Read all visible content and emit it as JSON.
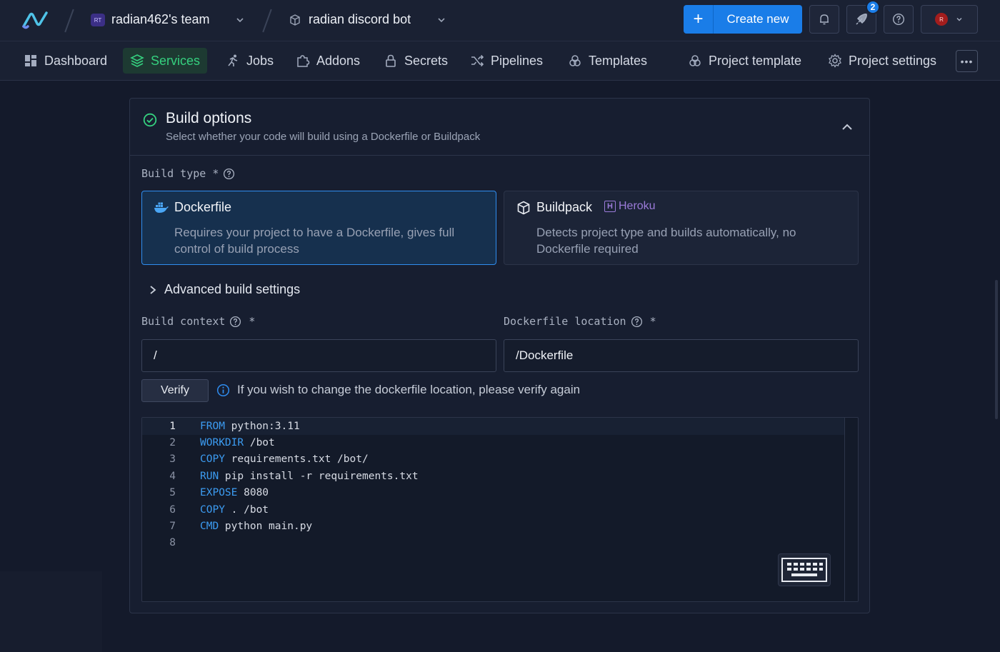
{
  "topbar": {
    "team_initials": "RT",
    "team_name": "radian462's team",
    "project_name": "radian discord bot",
    "create_label": "Create new",
    "notification_count": "2",
    "avatar_initial": "R",
    "accent_color": "#1a7de8"
  },
  "nav": {
    "items": [
      {
        "label": "Dashboard",
        "icon": "dashboard-icon"
      },
      {
        "label": "Services",
        "icon": "layers-icon",
        "active": true
      },
      {
        "label": "Jobs",
        "icon": "runner-icon"
      },
      {
        "label": "Addons",
        "icon": "puzzle-icon"
      },
      {
        "label": "Secrets",
        "icon": "lock-icon"
      },
      {
        "label": "Pipelines",
        "icon": "shuffle-icon"
      },
      {
        "label": "Templates",
        "icon": "templates-icon"
      },
      {
        "label": "Project template",
        "icon": "templates-icon"
      },
      {
        "label": "Project settings",
        "icon": "gear-icon"
      }
    ],
    "active_color": "#35d07f"
  },
  "build": {
    "title": "Build options",
    "subtitle": "Select whether your code will build using a Dockerfile or Buildpack",
    "build_type_label": "Build type *",
    "dockerfile": {
      "title": "Dockerfile",
      "desc": "Requires your project to have a Dockerfile, gives full control of build process"
    },
    "buildpack": {
      "title": "Buildpack",
      "tag": "Heroku",
      "desc": "Detects project type and builds automatically, no Dockerfile required"
    },
    "advanced_label": "Advanced build settings",
    "context_label": "Build context",
    "context_value": "/",
    "dockerfile_loc_label": "Dockerfile location",
    "dockerfile_loc_value": "/Dockerfile",
    "required_mark": "*",
    "verify_label": "Verify",
    "verify_info": "If you wish to change the dockerfile location, please verify again"
  },
  "editor": {
    "lines": [
      {
        "n": "1",
        "kw": "FROM",
        "rest": " python:3.11"
      },
      {
        "n": "2",
        "kw": "WORKDIR",
        "rest": " /bot"
      },
      {
        "n": "3",
        "kw": "COPY",
        "rest": " requirements.txt /bot/"
      },
      {
        "n": "4",
        "kw": "RUN",
        "rest": " pip install -r requirements.txt"
      },
      {
        "n": "5",
        "kw": "EXPOSE",
        "rest": " 8080"
      },
      {
        "n": "6",
        "kw": "COPY",
        "rest": " . /bot"
      },
      {
        "n": "7",
        "kw": "CMD",
        "rest": " python main.py"
      },
      {
        "n": "8",
        "kw": "",
        "rest": ""
      }
    ]
  }
}
